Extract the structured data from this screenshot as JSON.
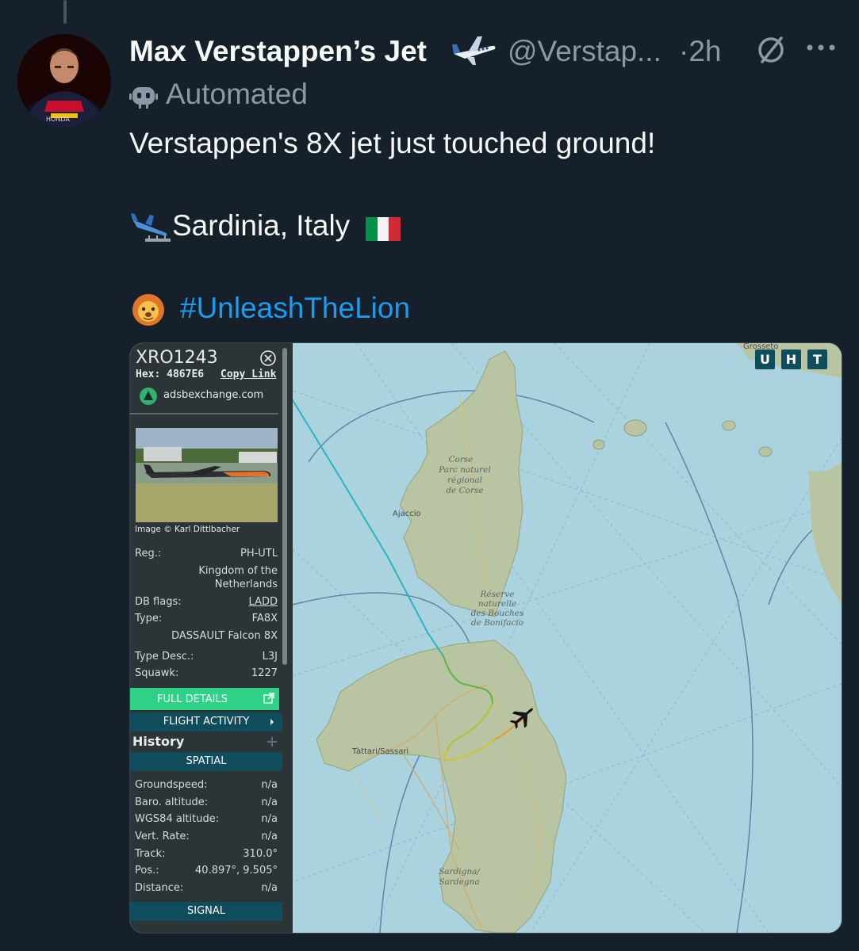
{
  "tweet": {
    "display_name": "Max Verstappen’s Jet",
    "handle": "@Verstap...",
    "separator": "·",
    "time": "2h",
    "automated_label": "Automated",
    "text_line1": "Verstappen's 8X jet just touched ground!",
    "location": "Sardinia, Italy",
    "hashtag": "#UnleashTheLion",
    "icons": [
      "plane-emoji",
      "airplane-arrival-emoji",
      "italy-flag-emoji",
      "lion-emoji",
      "robot-icon",
      "mute-icon",
      "more-icon"
    ]
  },
  "tracker": {
    "callsign": "XRO1243",
    "hex_label": "Hex:",
    "hex_value": "4867E6",
    "copy_link": "Copy Link",
    "source": "adsbexchange.com",
    "image_credit": "Image © Karl Dittlbacher",
    "reg_label": "Reg.:",
    "reg_value": "PH-UTL",
    "country_line1": "Kingdom of the",
    "country_line2": "Netherlands",
    "dbflags_label": "DB flags:",
    "dbflags_value": "LADD",
    "type_label": "Type:",
    "type_value": "FA8X",
    "type_full": "DASSAULT Falcon 8X",
    "typedesc_label": "Type Desc.:",
    "typedesc_value": "L3J",
    "squawk_label": "Squawk:",
    "squawk_value": "1227",
    "full_details": "FULL DETAILS",
    "flight_activity": "FLIGHT ACTIVITY",
    "history": "History",
    "spatial": "SPATIAL",
    "groundspeed_label": "Groundspeed:",
    "groundspeed_value": "n/a",
    "baro_label": "Baro. altitude:",
    "baro_value": "n/a",
    "wgs_label": "WGS84 altitude:",
    "wgs_value": "n/a",
    "vert_label": "Vert. Rate:",
    "vert_value": "n/a",
    "track_label": "Track:",
    "track_value": "310.0°",
    "pos_label": "Pos.:",
    "pos_value": "40.897°, 9.505°",
    "distance_label": "Distance:",
    "distance_value": "n/a",
    "signal": "SIGNAL",
    "map_buttons": [
      "U",
      "H",
      "T"
    ],
    "map_labels": {
      "grosseto": "Grosseto",
      "corse": "Corse",
      "parc1": "Parc naturel",
      "parc2": "régional",
      "parc3": "de Corse",
      "ajaccio": "Ajaccio",
      "res1": "Réserve",
      "res2": "naturelle",
      "res3": "des Bouches",
      "res4": "de Bonifacio",
      "sassari": "Tàttari/Sassari",
      "sard1": "Sardigna/",
      "sard2": "Sardegna"
    }
  },
  "colors": {
    "background": "#15202b",
    "text": "#f7f9f9",
    "muted": "#8b98a5",
    "link": "#1d9bf0",
    "sea": "#aad3df",
    "land": "#b9c5a2",
    "panel": "#2b3538",
    "panel_button": "#0f4c5c",
    "details_button": "#2fd187"
  }
}
